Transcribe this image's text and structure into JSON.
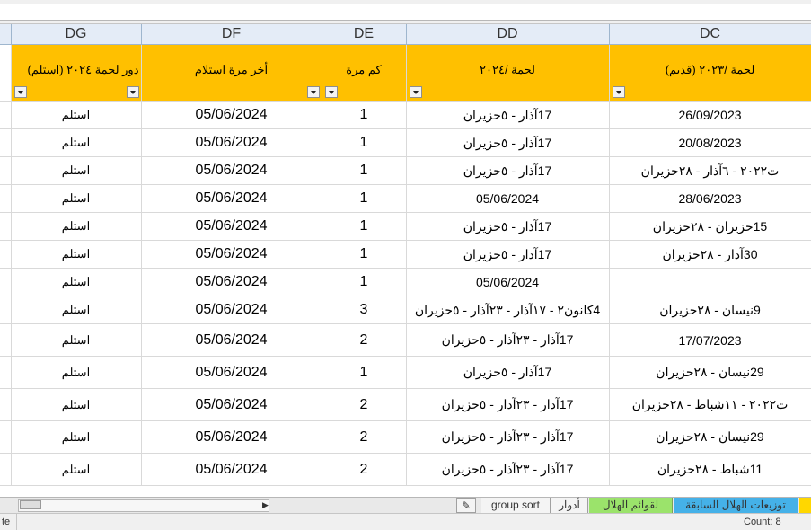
{
  "columns": {
    "dg": "DG",
    "df": "DF",
    "de": "DE",
    "dd": "DD",
    "dc": "DC"
  },
  "headers": {
    "dg": "دور لحمة ٢٠٢٤ (استلم)",
    "df": "أخر مرة استلام",
    "de": "كم مرة",
    "dd": "لحمة /٢٠٢٤",
    "dc": "لحمة /٢٠٢٣ (قديم)"
  },
  "rows": [
    {
      "dg": "استلم",
      "df": "05/06/2024",
      "de": "1",
      "dd": "17آذار - ٥حزيران",
      "dc": "26/09/2023"
    },
    {
      "dg": "استلم",
      "df": "05/06/2024",
      "de": "1",
      "dd": "17آذار - ٥حزيران",
      "dc": "20/08/2023"
    },
    {
      "dg": "استلم",
      "df": "05/06/2024",
      "de": "1",
      "dd": "17آذار - ٥حزيران",
      "dc": "ت٢٠٢٢ - ٦آذار - ٢٨حزيران"
    },
    {
      "dg": "استلم",
      "df": "05/06/2024",
      "de": "1",
      "dd": "05/06/2024",
      "dc": "28/06/2023"
    },
    {
      "dg": "استلم",
      "df": "05/06/2024",
      "de": "1",
      "dd": "17آذار - ٥حزيران",
      "dc": "15حزيران - ٢٨حزيران"
    },
    {
      "dg": "استلم",
      "df": "05/06/2024",
      "de": "1",
      "dd": "17آذار - ٥حزيران",
      "dc": "30آذار - ٢٨حزيران"
    },
    {
      "dg": "استلم",
      "df": "05/06/2024",
      "de": "1",
      "dd": "05/06/2024",
      "dc": ""
    },
    {
      "dg": "استلم",
      "df": "05/06/2024",
      "de": "3",
      "dd": "4كانون٢ - ١٧آذار - ٢٣آذار - ٥حزيران",
      "dc": "9نيسان - ٢٨حزيران"
    },
    {
      "dg": "استلم",
      "df": "05/06/2024",
      "de": "2",
      "dd": "17آذار - ٢٣آذار - ٥حزيران",
      "dc": "17/07/2023"
    },
    {
      "dg": "استلم",
      "df": "05/06/2024",
      "de": "1",
      "dd": "17آذار - ٥حزيران",
      "dc": "29نيسان - ٢٨حزيران"
    },
    {
      "dg": "استلم",
      "df": "05/06/2024",
      "de": "2",
      "dd": "17آذار - ٢٣آذار - ٥حزيران",
      "dc": "ت٢٠٢٢ - ١١شباط - ٢٨حزيران"
    },
    {
      "dg": "استلم",
      "df": "05/06/2024",
      "de": "2",
      "dd": "17آذار - ٢٣آذار - ٥حزيران",
      "dc": "29نيسان - ٢٨حزيران"
    },
    {
      "dg": "استلم",
      "df": "05/06/2024",
      "de": "2",
      "dd": "17آذار - ٢٣آذار - ٥حزيران",
      "dc": "11شباط - ٢٨حزيران"
    }
  ],
  "tabs": {
    "t1": "group sort",
    "t2": "أدوار",
    "t3": "لقوائم الهلال",
    "t4": "توزيعات الهلال السابقة"
  },
  "status": {
    "left": "te",
    "count": "Count: 8"
  },
  "colors": {
    "header": "#ffc000",
    "tab_green": "#9be36b",
    "tab_blue": "#45b1e8",
    "tab_yellow": "#ffd700"
  }
}
